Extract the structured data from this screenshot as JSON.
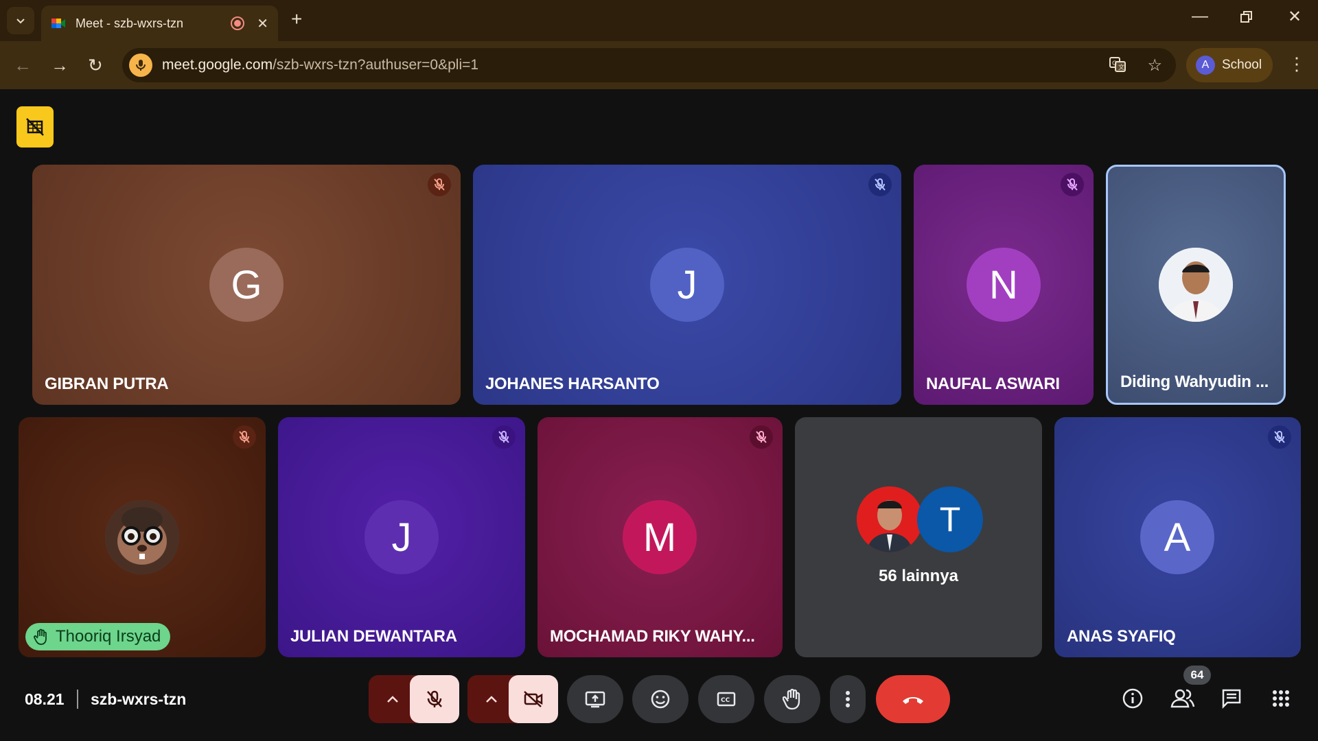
{
  "browser": {
    "tab_title": "Meet - szb-wxrs-tzn",
    "url_host": "meet.google.com",
    "url_rest": "/szb-wxrs-tzn?authuser=0&pli=1",
    "profile_initial": "A",
    "profile_label": "School"
  },
  "participants": [
    {
      "name": "GIBRAN PUTRA",
      "initial": "G",
      "avatar_color": "#9a6b5a",
      "muted": true
    },
    {
      "name": "JOHANES HARSANTO",
      "initial": "J",
      "avatar_color": "#5162c4",
      "muted": true
    },
    {
      "name": "NAUFAL ASWARI",
      "initial": "N",
      "avatar_color": "#a23fc0",
      "muted": true
    },
    {
      "name": "Diding Wahyudin ...",
      "initial": "",
      "avatar_color": "#e9eef5",
      "muted": false
    },
    {
      "name": "Thooriq Irsyad",
      "initial": "",
      "avatar_color": "#6b4a3a",
      "muted": true,
      "hand_raised": true
    },
    {
      "name": "JULIAN DEWANTARA",
      "initial": "J",
      "avatar_color": "#5d2fb0",
      "muted": true
    },
    {
      "name": "MOCHAMAD RIKY WAHY...",
      "initial": "M",
      "avatar_color": "#c2185b",
      "muted": true
    },
    {
      "name": "ANAS SYAFIQ",
      "initial": "A",
      "avatar_color": "#5a67c8",
      "muted": true
    }
  ],
  "others_tile": {
    "label": "56 lainnya",
    "initial": "T"
  },
  "bottom_bar": {
    "time": "08.21",
    "meeting_code": "szb-wxrs-tzn",
    "participant_count": "64"
  },
  "colors": {
    "end_call": "#e33b33",
    "hand_badge": "#6dd58c",
    "active_speaker_border": "#a8c7fa"
  }
}
